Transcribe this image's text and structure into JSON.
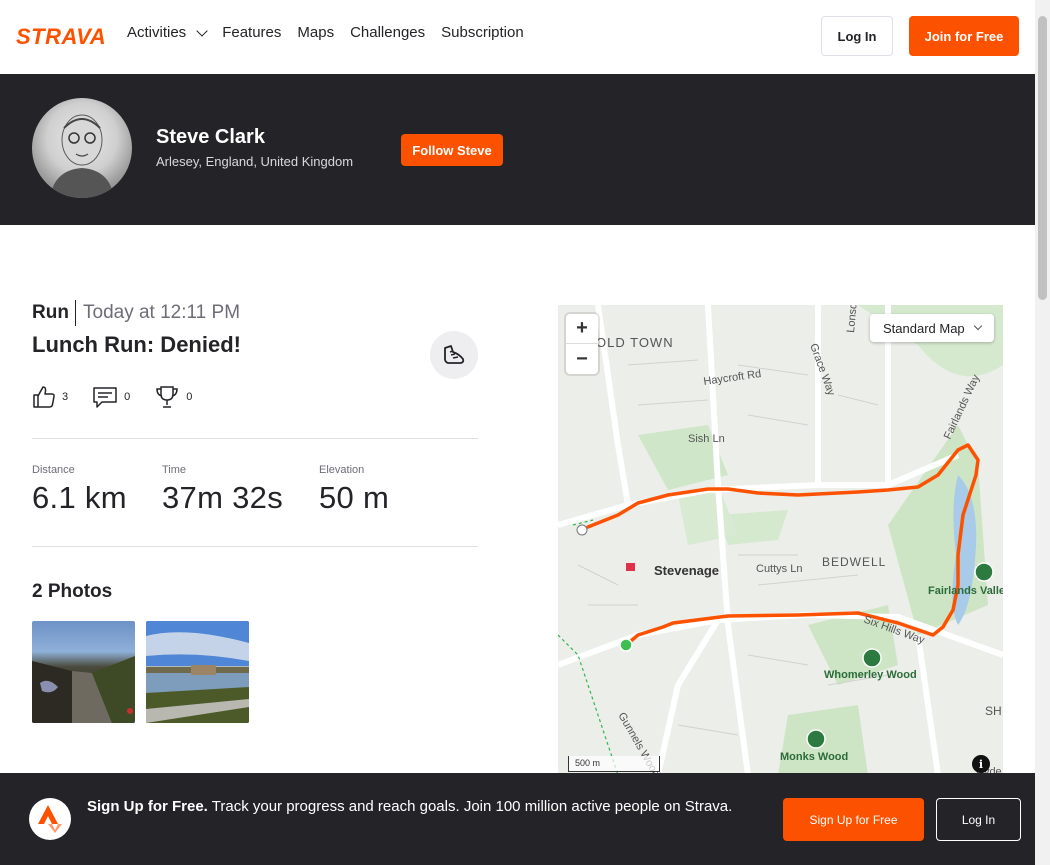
{
  "nav": {
    "brand": "STRAVA",
    "links": [
      "Activities",
      "Features",
      "Maps",
      "Challenges",
      "Subscription"
    ],
    "login_label": "Log In",
    "join_label": "Join for Free",
    "accent": "#fc5200"
  },
  "athlete": {
    "name": "Steve Clark",
    "location": "Arlesey, England, United Kingdom",
    "follow_label": "Follow Steve"
  },
  "activity": {
    "type": "Run",
    "time": "Today at 12:11 PM",
    "title": "Lunch Run: Denied!",
    "kudos": "3",
    "comments": "0",
    "achievements": "0",
    "stats": [
      {
        "label": "Distance",
        "value": "6.1 km"
      },
      {
        "label": "Time",
        "value": "37m 32s"
      },
      {
        "label": "Elevation",
        "value": "50 m"
      }
    ],
    "photos_title": "2 Photos"
  },
  "map": {
    "style_label": "Standard Map",
    "scale_label": "500 m",
    "labels": {
      "old_town": "OLD TOWN",
      "haycroft": "Haycroft Rd",
      "grace": "Grace Way",
      "lonsdale": "Lonsdale Rd",
      "fairlands_way": "Fairlands Way",
      "sish": "Sish Ln",
      "stevenage": "Stevenage",
      "cuttys": "Cuttys Ln",
      "bedwell": "BEDWELL",
      "fairlands_valley": "Fairlands Valley",
      "six_hills": "Six Hills Way",
      "whomerley": "Whomerley Wood",
      "monks": "Monks Wood",
      "gunnels": "Gunnels Wood",
      "sh": "SH",
      "hy": "Hyde Way"
    }
  },
  "banner": {
    "headline": "Sign Up for Free.",
    "text": "Track your progress and reach goals. Join 100 million active people on Strava.",
    "signup_label": "Sign Up for Free",
    "login_label": "Log In"
  }
}
